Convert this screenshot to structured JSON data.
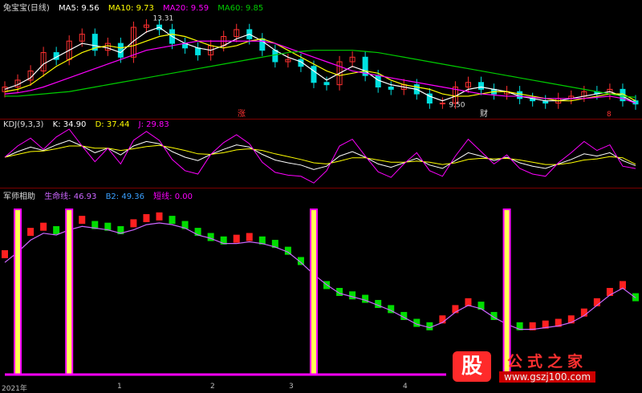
{
  "price_header": {
    "name": "兔宝宝(日线)",
    "ma5": "MA5: 9.56",
    "ma10": "MA10: 9.73",
    "ma20": "MA20: 9.59",
    "ma60": "MA60: 9.85"
  },
  "kdj_header": {
    "name": "KDJ(9,3,3)",
    "k": "K: 34.90",
    "d": "D: 37.44",
    "j": "J: 29.83"
  },
  "jsz_header": {
    "name": "军师相助",
    "sm": "生命线: 46.93",
    "b2": "B2: 49.36",
    "dx": "短线: 0.00"
  },
  "annotations": {
    "high": "13.31",
    "low": "9.50",
    "zhang": "涨",
    "cai": "财",
    "mark": "8"
  },
  "axis": {
    "year": "2021年",
    "m1": "1",
    "m2": "2",
    "m3": "3",
    "m4": "4"
  },
  "watermark": {
    "logo": "股",
    "site_cn": "公式之家",
    "site_url": "www.gszj100.com"
  },
  "colors": {
    "ma5": "#ffffff",
    "ma10": "#ffff00",
    "ma20": "#ff00ff",
    "ma60": "#00cc00",
    "up": "#ff3030",
    "down": "#00e0e0",
    "k": "#ffffff",
    "d": "#ffff00",
    "j": "#ff00ff",
    "rise": "#ff2020",
    "fall": "#00dd00",
    "spike": "#ffff55",
    "spikeEdge": "#ff00ff",
    "life": "#cc66ff",
    "b2": "#3aa0ff"
  },
  "chart_data": [
    {
      "type": "candlestick",
      "title": "兔宝宝(日线)",
      "series": [
        {
          "name": "MA5",
          "values": [
            10.2,
            10.4,
            10.7,
            11.3,
            11.6,
            11.9,
            12.2,
            12.1,
            12.0,
            11.8,
            12.3,
            12.7,
            12.9,
            12.5,
            12.2,
            12.0,
            11.9,
            12.1,
            12.4,
            12.6,
            12.3,
            11.9,
            11.6,
            11.4,
            11.0,
            10.6,
            10.9,
            11.2,
            11.0,
            10.6,
            10.4,
            10.3,
            10.2,
            9.9,
            9.7,
            9.9,
            10.2,
            10.3,
            10.2,
            10.1,
            9.9,
            9.8,
            9.7,
            9.7,
            9.8,
            9.9,
            10.0,
            10.1,
            9.9,
            9.6
          ]
        },
        {
          "name": "MA10",
          "values": [
            10.1,
            10.2,
            10.4,
            10.8,
            11.2,
            11.5,
            11.8,
            12.0,
            12.1,
            12.0,
            12.1,
            12.3,
            12.5,
            12.6,
            12.5,
            12.3,
            12.1,
            12.0,
            12.1,
            12.3,
            12.4,
            12.2,
            11.9,
            11.6,
            11.3,
            11.0,
            10.8,
            10.9,
            11.0,
            10.9,
            10.6,
            10.4,
            10.3,
            10.2,
            10.0,
            9.9,
            9.9,
            10.0,
            10.1,
            10.1,
            10.0,
            9.9,
            9.8,
            9.7,
            9.7,
            9.8,
            9.9,
            10.0,
            10.0,
            9.7
          ]
        },
        {
          "name": "MA20",
          "values": [
            10.0,
            10.05,
            10.15,
            10.3,
            10.5,
            10.7,
            10.9,
            11.1,
            11.3,
            11.5,
            11.7,
            11.9,
            12.0,
            12.1,
            12.2,
            12.3,
            12.3,
            12.3,
            12.3,
            12.3,
            12.3,
            12.2,
            12.0,
            11.8,
            11.6,
            11.4,
            11.2,
            11.0,
            10.9,
            10.8,
            10.7,
            10.6,
            10.5,
            10.4,
            10.3,
            10.2,
            10.1,
            10.0,
            9.95,
            9.9,
            9.9,
            9.85,
            9.8,
            9.8,
            9.8,
            9.8,
            9.85,
            9.9,
            9.8,
            9.6
          ]
        },
        {
          "name": "MA60",
          "values": [
            9.9,
            9.9,
            9.95,
            10.0,
            10.05,
            10.1,
            10.2,
            10.3,
            10.4,
            10.5,
            10.6,
            10.7,
            10.8,
            10.9,
            11.0,
            11.1,
            11.2,
            11.3,
            11.4,
            11.5,
            11.6,
            11.7,
            11.8,
            11.85,
            11.9,
            11.9,
            11.9,
            11.9,
            11.85,
            11.8,
            11.7,
            11.6,
            11.5,
            11.4,
            11.3,
            11.2,
            11.1,
            11.0,
            10.9,
            10.8,
            10.7,
            10.6,
            10.5,
            10.4,
            10.3,
            10.2,
            10.1,
            10.0,
            9.9,
            9.85
          ]
        }
      ],
      "close": [
        10.3,
        10.6,
        11.0,
        11.8,
        11.5,
        12.3,
        12.6,
        11.9,
        12.2,
        11.6,
        12.9,
        13.0,
        12.8,
        12.2,
        12.0,
        11.7,
        12.1,
        12.5,
        12.8,
        12.4,
        11.9,
        11.4,
        11.5,
        11.2,
        10.5,
        10.4,
        11.4,
        11.6,
        10.8,
        10.3,
        10.2,
        10.4,
        10.0,
        9.6,
        9.6,
        10.3,
        10.5,
        10.2,
        10.0,
        10.1,
        9.8,
        9.7,
        9.6,
        9.8,
        9.9,
        10.1,
        10.0,
        10.2,
        9.7,
        9.56
      ],
      "annotations": {
        "high": 13.31,
        "low": 9.5
      }
    },
    {
      "type": "line",
      "title": "KDJ(9,3,3)",
      "series": [
        {
          "name": "K",
          "values": [
            50,
            60,
            68,
            62,
            72,
            80,
            70,
            58,
            66,
            54,
            70,
            78,
            74,
            60,
            50,
            44,
            55,
            64,
            72,
            68,
            55,
            45,
            40,
            36,
            28,
            34,
            52,
            60,
            50,
            38,
            32,
            40,
            48,
            36,
            30,
            44,
            58,
            52,
            44,
            50,
            40,
            34,
            30,
            38,
            46,
            56,
            52,
            58,
            44,
            34.9
          ]
        },
        {
          "name": "D",
          "values": [
            50,
            55,
            60,
            61,
            65,
            70,
            70,
            66,
            66,
            62,
            65,
            69,
            71,
            67,
            62,
            56,
            55,
            58,
            63,
            65,
            62,
            56,
            51,
            46,
            40,
            38,
            43,
            49,
            49,
            45,
            41,
            41,
            43,
            41,
            37,
            40,
            46,
            48,
            47,
            48,
            45,
            41,
            37,
            37,
            40,
            45,
            47,
            51,
            49,
            37.44
          ]
        },
        {
          "name": "J",
          "values": [
            50,
            70,
            84,
            64,
            86,
            100,
            70,
            42,
            66,
            38,
            80,
            96,
            80,
            46,
            26,
            20,
            55,
            76,
            90,
            74,
            41,
            23,
            18,
            16,
            4,
            26,
            70,
            82,
            52,
            24,
            14,
            38,
            58,
            26,
            16,
            52,
            82,
            60,
            38,
            54,
            30,
            20,
            16,
            40,
            58,
            78,
            62,
            72,
            34,
            29.83
          ]
        }
      ]
    },
    {
      "type": "bar",
      "title": "军师相助",
      "series": [
        {
          "name": "生命线",
          "values": [
            72,
            78,
            85,
            88,
            86,
            90,
            92,
            89,
            88,
            86,
            90,
            93,
            94,
            92,
            89,
            85,
            82,
            80,
            81,
            82,
            80,
            78,
            74,
            68,
            60,
            54,
            50,
            48,
            46,
            43,
            40,
            36,
            32,
            30,
            34,
            40,
            44,
            42,
            36,
            32,
            30,
            30,
            31,
            32,
            34,
            38,
            44,
            50,
            54,
            46.93
          ]
        },
        {
          "name": "B2",
          "values": [
            70,
            76,
            83,
            87,
            86,
            89,
            91,
            90,
            89,
            87,
            89,
            92,
            93,
            92,
            90,
            86,
            84,
            81,
            81,
            82,
            81,
            79,
            76,
            70,
            63,
            57,
            52,
            50,
            48,
            45,
            42,
            38,
            34,
            32,
            35,
            41,
            45,
            43,
            38,
            34,
            31,
            31,
            32,
            33,
            35,
            39,
            45,
            51,
            55,
            49.36
          ]
        },
        {
          "name": "短线",
          "values": [
            0,
            100,
            0,
            0,
            0,
            100,
            0,
            0,
            0,
            0,
            0,
            0,
            0,
            0,
            0,
            0,
            0,
            0,
            0,
            0,
            0,
            0,
            0,
            0,
            100,
            0,
            0,
            0,
            0,
            0,
            0,
            0,
            0,
            0,
            0,
            0,
            0,
            0,
            0,
            100,
            0,
            0,
            0,
            0,
            0,
            0,
            0,
            0,
            0,
            0.0
          ]
        }
      ]
    }
  ]
}
